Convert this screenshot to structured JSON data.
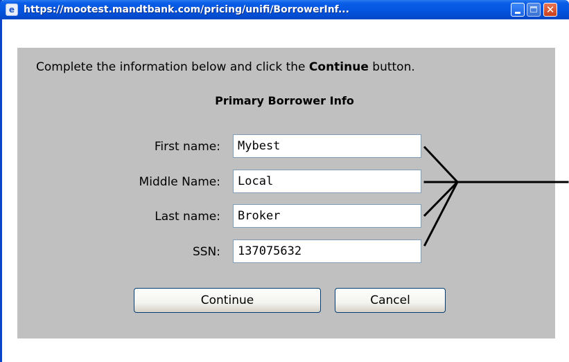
{
  "window": {
    "title": "https://mootest.mandtbank.com/pricing/unifi/BorrowerInf...",
    "icon": "ie-page-icon",
    "controls": [
      "minimize-icon",
      "maximize-icon",
      "close-icon"
    ],
    "close_glyph": "✕"
  },
  "dialog": {
    "instruction_before": "Complete the information below and click the ",
    "instruction_bold": "Continue",
    "instruction_after": " button.",
    "section_title": "Primary Borrower Info",
    "fields": [
      {
        "label": "First name:",
        "value": "Mybest"
      },
      {
        "label": "Middle Name:",
        "value": "Local"
      },
      {
        "label": "Last name:",
        "value": "Broker"
      },
      {
        "label": "SSN:",
        "value": "137075632"
      }
    ],
    "buttons": {
      "continue_label": "Continue",
      "cancel_label": "Cancel"
    }
  },
  "colors": {
    "titlebar": "#0453dd",
    "dialog_bg": "#c0c0c0",
    "input_border": "#7f9db9"
  }
}
